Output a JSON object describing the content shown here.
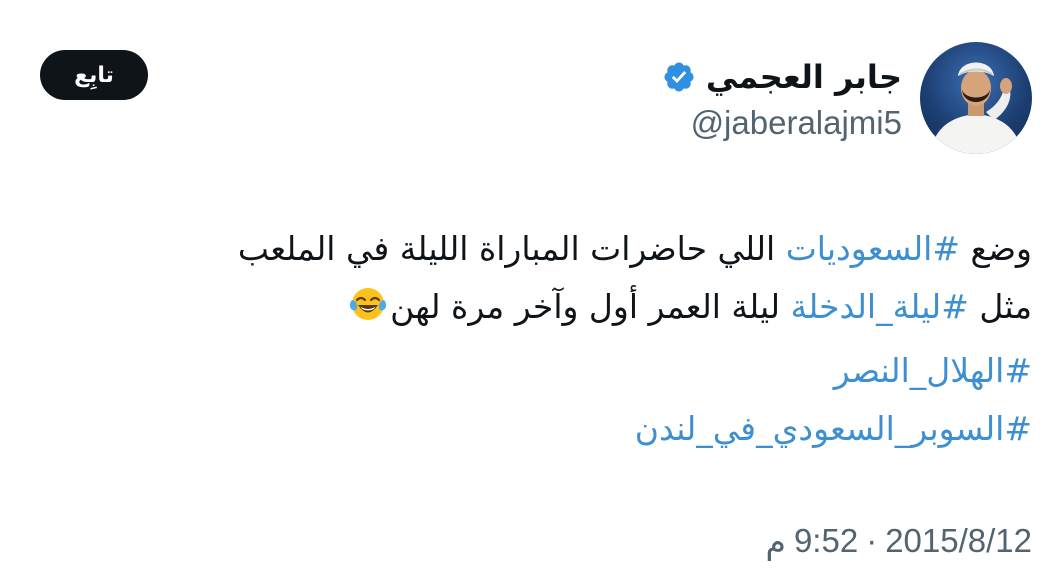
{
  "author": {
    "display_name": "جابر العجمي",
    "handle": "@jaberalajmi5",
    "verified_icon": "verified-badge-icon",
    "avatar_icon": "profile-photo"
  },
  "follow_button": {
    "label": "تابِع"
  },
  "tweet": {
    "line1": {
      "t1": "وضع ",
      "h1": "#السعوديات",
      "t2": " اللي حاضرات المباراة الليلة في الملعب"
    },
    "line2": {
      "t1": "مثل ",
      "h1": "#ليلة_الدخلة",
      "t2": " ليلة العمر أول وآخر مرة لهن",
      "emoji": "face-with-tears-of-joy-emoji"
    },
    "line3": {
      "h1": "#الهلال_النصر"
    },
    "line4": {
      "h1": "#السوبر_السعودي_في_لندن"
    }
  },
  "timestamp": {
    "date": "2015/8/12",
    "separator": "·",
    "time": "9:52",
    "ampm": "م"
  },
  "colors": {
    "hashtag": "#3d8fd1",
    "verified": "#2f8fe0",
    "muted": "#536471",
    "text": "#0f1419",
    "button_bg": "#0f1419"
  }
}
